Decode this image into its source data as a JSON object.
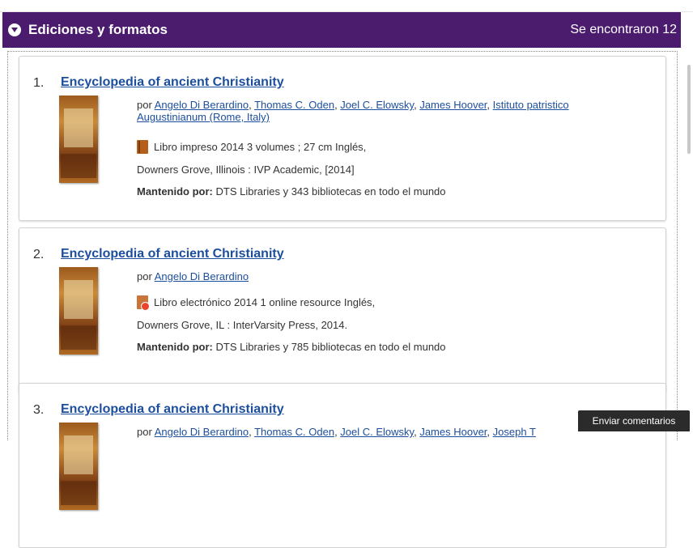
{
  "header": {
    "title": "Ediciones y formatos",
    "count": "Se encontraron 12"
  },
  "results": [
    {
      "num": "1.",
      "title": "Encyclopedia of ancient Christianity",
      "por": "por",
      "authors": [
        "Angelo Di Berardino",
        "Thomas C. Oden",
        "Joel C. Elowsky",
        "James Hoover",
        "Istituto patristico Augustinianum (Rome, Italy)"
      ],
      "format": "Libro impreso 2014 3 volumes ; 27 cm Inglés,",
      "publisher": "Downers Grove, Illinois : IVP Academic, [2014]",
      "held_label": "Mantenido por:",
      "held_text": "DTS Libraries y 343 bibliotecas en todo el mundo"
    },
    {
      "num": "2.",
      "title": "Encyclopedia of ancient Christianity",
      "por": "por",
      "authors": [
        "Angelo Di Berardino"
      ],
      "format": "Libro electrónico 2014 1 online resource Inglés,",
      "publisher": "Downers Grove, IL : InterVarsity Press, 2014.",
      "held_label": "Mantenido por:",
      "held_text": "DTS Libraries y 785 bibliotecas en todo el mundo"
    },
    {
      "num": "3.",
      "title": "Encyclopedia of ancient Christianity",
      "por": "por",
      "authors": [
        "Angelo Di Berardino",
        "Thomas C. Oden",
        "Joel C. Elowsky",
        "James Hoover",
        "Joseph T"
      ]
    }
  ],
  "feedback_label": "Enviar comentarios",
  "icons": {
    "print": "print-book-icon",
    "ebook": "ebook-icon",
    "toggle": "chevron-down-circle-icon"
  },
  "colors": {
    "header_bg": "#4b1c6e",
    "link": "#1c4e9e"
  }
}
